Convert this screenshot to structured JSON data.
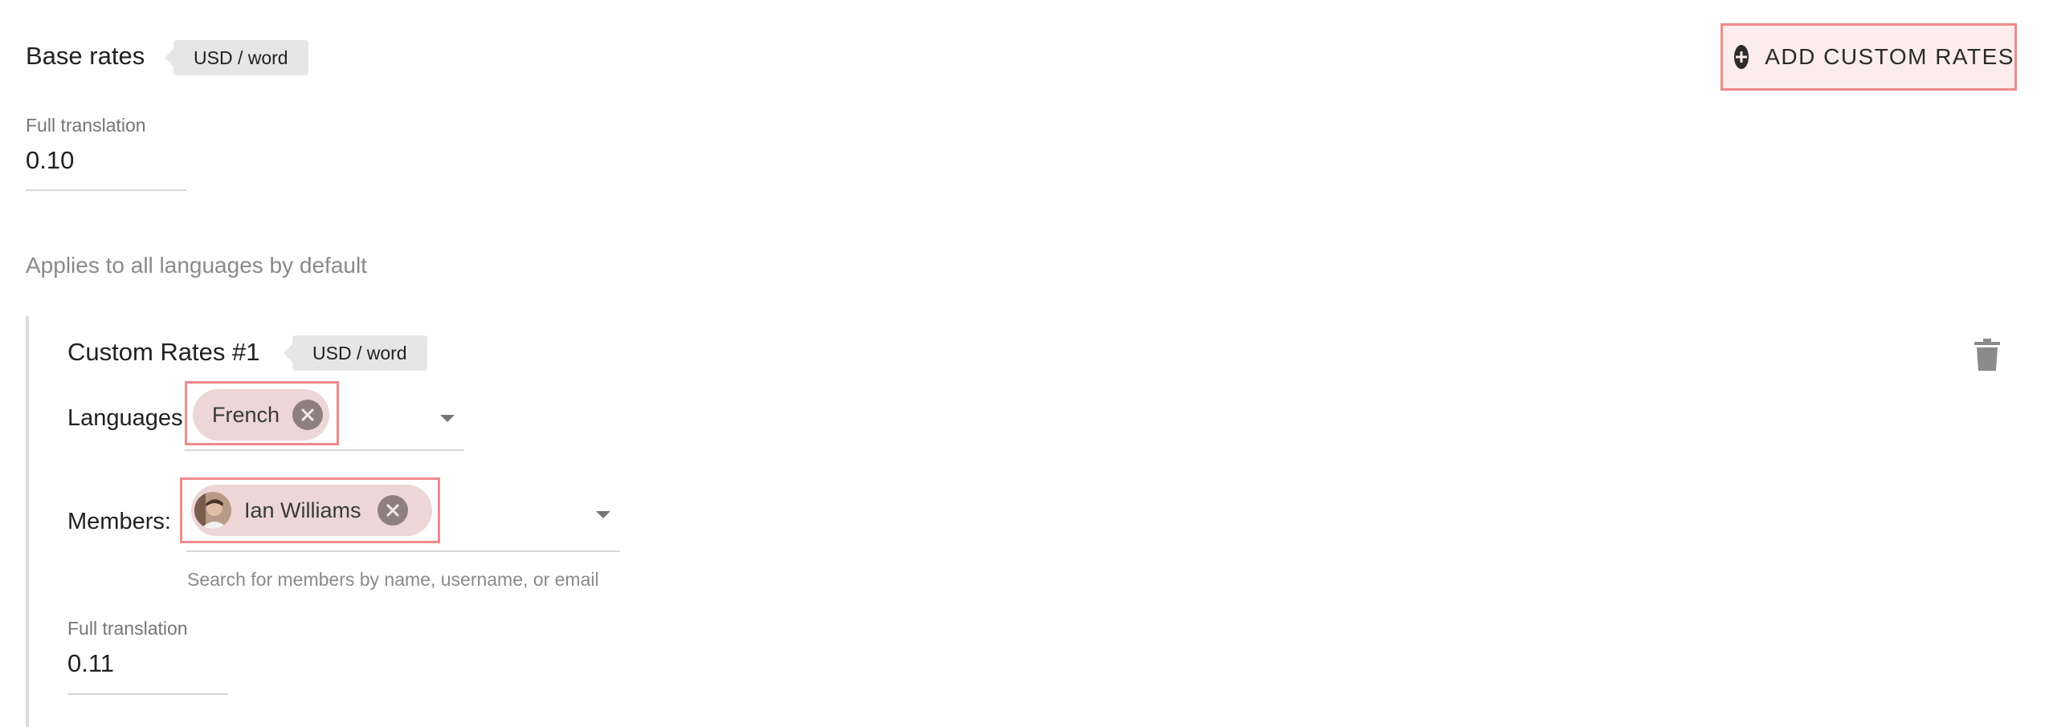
{
  "base_rates": {
    "title": "Base rates",
    "unit": "USD / word",
    "full_translation_label": "Full translation",
    "full_translation_value": "0.10",
    "hint": "Applies to all languages by default"
  },
  "actions": {
    "add_custom_rates": "ADD CUSTOM RATES"
  },
  "custom_rates": {
    "title": "Custom Rates #1",
    "unit": "USD / word",
    "languages_label": "Languages:",
    "languages": [
      "French"
    ],
    "members_label": "Members:",
    "members": [
      "Ian Williams"
    ],
    "members_helper": "Search for members by name, username, or email",
    "full_translation_label": "Full translation",
    "full_translation_value": "0.11"
  },
  "icons": {
    "add": "plus-circle-icon",
    "delete": "trash-icon",
    "remove_chip": "close-circle-icon",
    "dropdown": "caret-down-icon"
  },
  "colors": {
    "highlight_border": "#f08a8a",
    "chip_bg": "#ecd6d6",
    "tag_bg": "#e6e6e6"
  }
}
